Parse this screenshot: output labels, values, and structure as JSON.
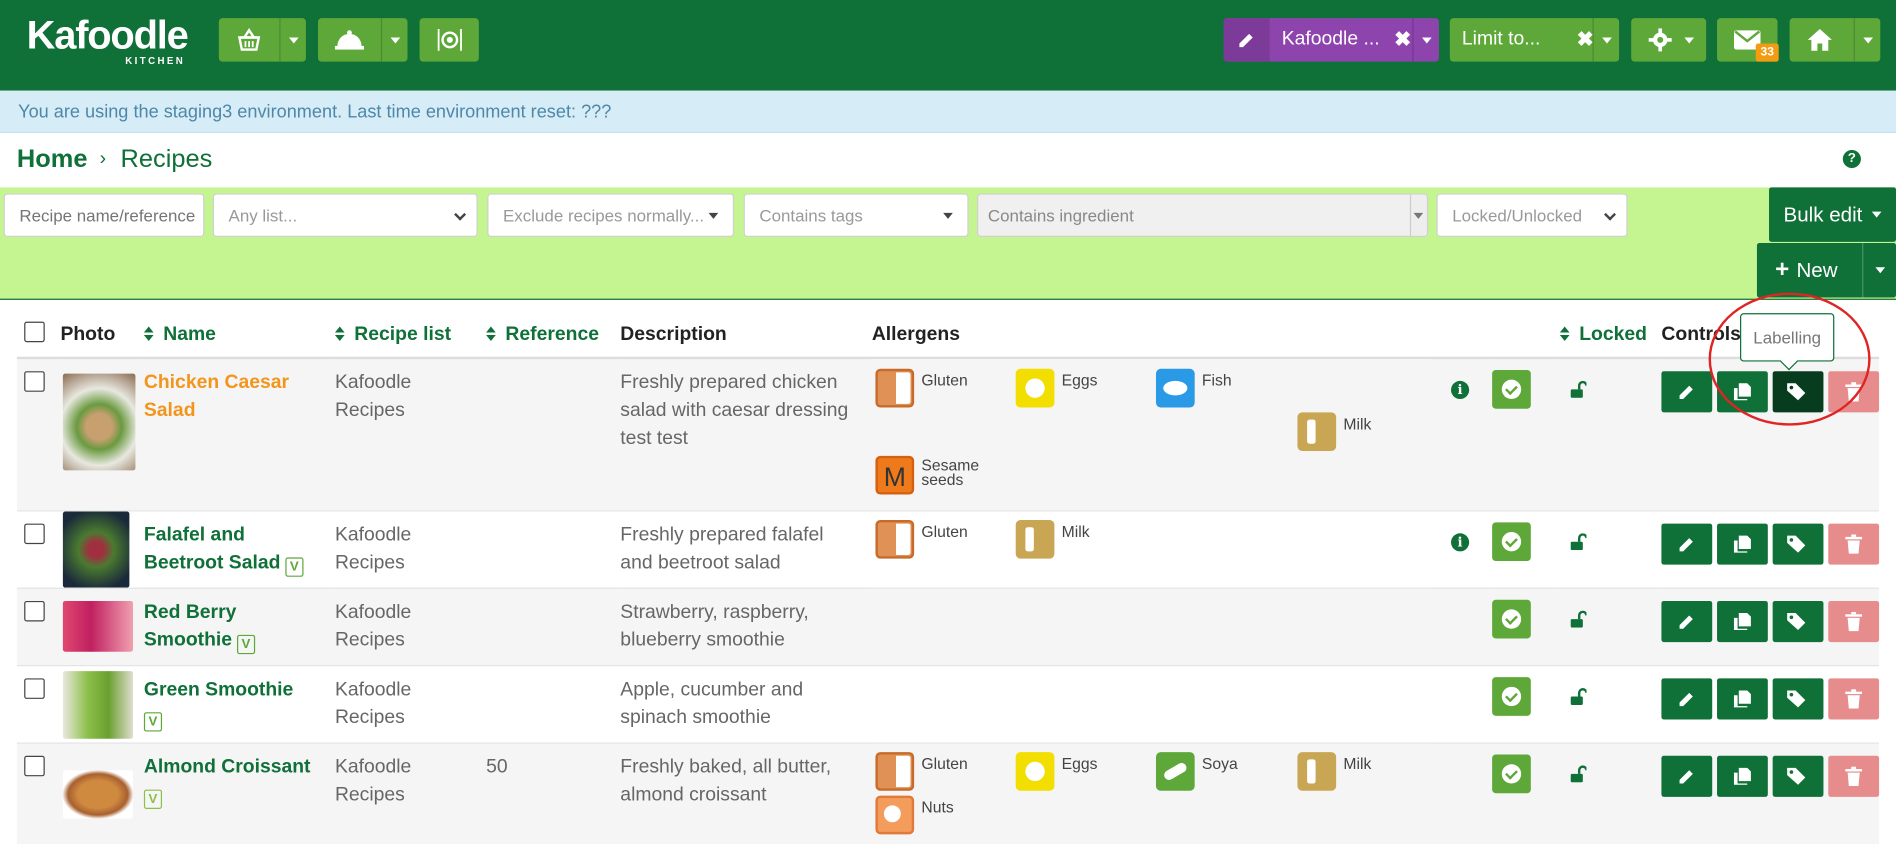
{
  "app": {
    "logo_text": "Kafoodle",
    "logo_sub": "KITCHEN"
  },
  "topbar": {
    "nav1_icon": "basket-icon",
    "nav2_icon": "cloche-icon",
    "nav3_icon": "plate-icon",
    "filter1_label": "Kafoodle ...",
    "filter2_label": "Limit to...",
    "mail_badge": "33",
    "colors": {
      "primary": "#0f7038",
      "accent": "#5ea83a",
      "purple": "#8e44ad",
      "badge": "#f39c12"
    }
  },
  "env": {
    "message": "You are using the staging3 environment. Last time environment reset: ???"
  },
  "breadcrumb": {
    "home": "Home",
    "current": "Recipes",
    "sep": "›",
    "help": "?"
  },
  "filters": {
    "search_placeholder": "Recipe name/reference",
    "list": "Any list...",
    "exclude": "Exclude recipes normally...",
    "tags": "Contains tags",
    "ingredient": "Contains ingredient",
    "locked": "Locked/Unlocked",
    "bulk_edit": "Bulk edit",
    "new_label": "New",
    "new_plus": "+"
  },
  "table": {
    "headers": {
      "photo": "Photo",
      "name": "Name",
      "list": "Recipe list",
      "reference": "Reference",
      "description": "Description",
      "allergens": "Allergens",
      "locked": "Locked",
      "controls": "Controls"
    },
    "rows": [
      {
        "name_l1": "Chicken Caesar",
        "name_l2": "Salad",
        "list_l1": "Kafoodle",
        "list_l2": "Recipes",
        "reference": "",
        "desc_l1": "Freshly prepared chicken",
        "desc_l2": "salad with caesar dressing",
        "desc_l3": "test test",
        "allergens": {
          "a": "Gluten",
          "b": "Eggs",
          "c": "Fish",
          "d": "Milk",
          "e_l1": "Sesame",
          "e_l2": "seeds"
        },
        "info": "i"
      },
      {
        "name_l1": "Falafel and",
        "name_l2": "Beetroot Salad",
        "list_l1": "Kafoodle",
        "list_l2": "Recipes",
        "reference": "",
        "desc_l1": "Freshly prepared falafel",
        "desc_l2": "and beetroot salad",
        "allergens": {
          "a": "Gluten",
          "b": "Milk"
        },
        "info": "i"
      },
      {
        "name_l1": "Red Berry",
        "name_l2": "Smoothie",
        "list_l1": "Kafoodle",
        "list_l2": "Recipes",
        "reference": "",
        "desc_l1": "Strawberry, raspberry,",
        "desc_l2": "blueberry smoothie"
      },
      {
        "name_l1": "Green Smoothie",
        "name_l2": "",
        "list_l1": "Kafoodle",
        "list_l2": "Recipes",
        "reference": "",
        "desc_l1": "Apple, cucumber and",
        "desc_l2": "spinach smoothie"
      },
      {
        "name_l1": "Almond Croissant",
        "name_l2": "",
        "list_l1": "Kafoodle",
        "list_l2": "Recipes",
        "reference": "50",
        "desc_l1": "Freshly baked, all butter,",
        "desc_l2": "almond croissant",
        "allergens": {
          "a": "Gluten",
          "b": "Eggs",
          "c": "Soya",
          "d": "Milk",
          "e": "Nuts"
        }
      }
    ],
    "vegan_mark": "V",
    "sesame_glyph": "M"
  },
  "tooltip": {
    "labelling": "Labelling"
  }
}
